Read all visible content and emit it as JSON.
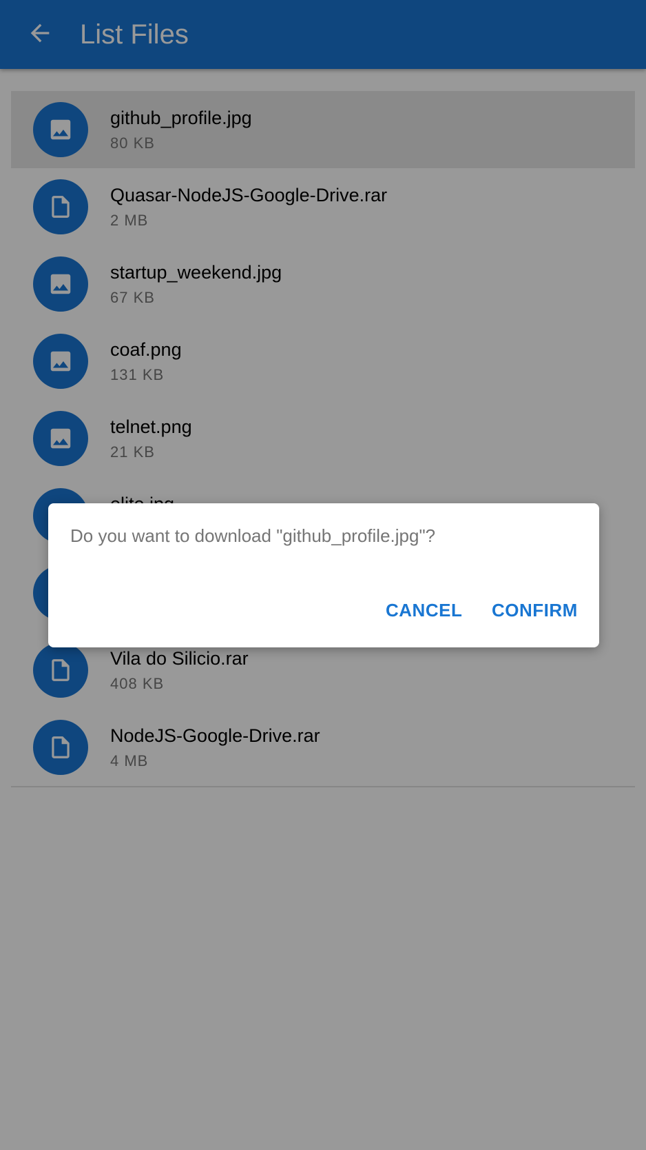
{
  "colors": {
    "primary": "#1976d2",
    "header_text": "#ffffff",
    "secondary_text": "#757575",
    "selected_row": "#e6e6e6",
    "scrim": "rgba(0,0,0,0.4)"
  },
  "header": {
    "back_icon": "arrow-left-icon",
    "title": "List Files"
  },
  "files": [
    {
      "name": "github_profile.jpg",
      "size": "80 KB",
      "icon": "image-icon",
      "selected": true
    },
    {
      "name": "Quasar-NodeJS-Google-Drive.rar",
      "size": "2 MB",
      "icon": "file-icon"
    },
    {
      "name": "startup_weekend.jpg",
      "size": "67 KB",
      "icon": "image-icon"
    },
    {
      "name": "coaf.png",
      "size": "131 KB",
      "icon": "image-icon"
    },
    {
      "name": "telnet.png",
      "size": "21 KB",
      "icon": "image-icon"
    },
    {
      "name": "elite.jpg",
      "size": "",
      "icon": "image-icon"
    },
    {
      "name": "",
      "size": "",
      "icon": "file-icon"
    },
    {
      "name": "Vila do Silicio.rar",
      "size": "408 KB",
      "icon": "file-icon"
    },
    {
      "name": "NodeJS-Google-Drive.rar",
      "size": "4 MB",
      "icon": "file-icon"
    }
  ],
  "dialog": {
    "message": "Do you want to download \"github_profile.jpg\"?",
    "cancel_label": "CANCEL",
    "confirm_label": "CONFIRM"
  }
}
